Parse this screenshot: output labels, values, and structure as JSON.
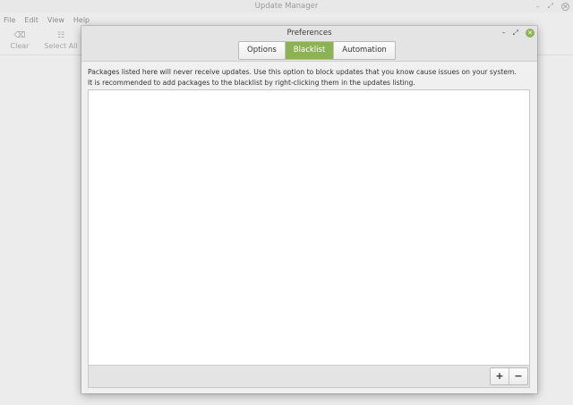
{
  "background_window": {
    "title": "Update Manager",
    "menu": [
      "File",
      "Edit",
      "View",
      "Help"
    ],
    "toolbar": [
      {
        "icon": "clear-icon",
        "glyph": "⌫",
        "label": "Clear"
      },
      {
        "icon": "select-all-icon",
        "glyph": "☷",
        "label": "Select All"
      }
    ],
    "controls": {
      "minimize": "–",
      "restore": "⤢",
      "close": "✕"
    }
  },
  "dialog": {
    "title": "Preferences",
    "controls": {
      "minimize": "–",
      "restore": "⤢",
      "close": "✕"
    },
    "tabs": [
      {
        "label": "Options",
        "active": false
      },
      {
        "label": "Blacklist",
        "active": true
      },
      {
        "label": "Automation",
        "active": false
      }
    ],
    "description_line1": "Packages listed here will never receive updates. Use this option to block updates that you know cause issues on your system.",
    "description_line2": "It is recommended to add packages to the blacklist by right-clicking them in the updates listing.",
    "blacklist_items": [],
    "add_glyph": "+",
    "remove_glyph": "−"
  },
  "colors": {
    "accent": "#8db255"
  }
}
